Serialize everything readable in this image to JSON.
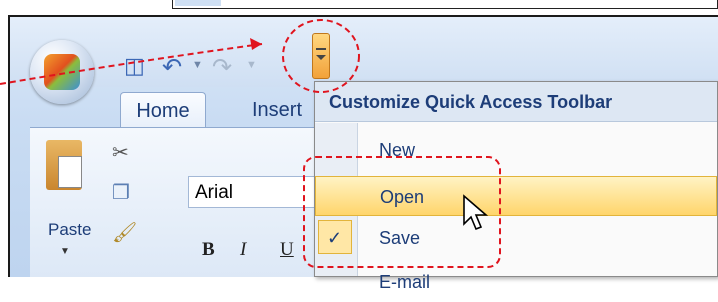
{
  "quick_access": {
    "save_icon": "save-icon",
    "undo_icon": "undo-icon",
    "redo_icon": "redo-icon",
    "customize_icon": "customize-dropdown-icon"
  },
  "tabs": [
    {
      "label": "Home"
    },
    {
      "label": "Insert"
    }
  ],
  "ribbon": {
    "paste_label": "Paste",
    "font_name": "Arial",
    "bold": "B",
    "italic": "I",
    "underline": "U"
  },
  "menu": {
    "title": "Customize Quick Access Toolbar",
    "items": [
      {
        "label": "New",
        "checked": false
      },
      {
        "label": "Open",
        "checked": false,
        "highlighted": true
      },
      {
        "label": "Save",
        "checked": true
      },
      {
        "label": "E-mail",
        "checked": false
      }
    ],
    "check_mark": "✓"
  },
  "colors": {
    "annotation": "#e0141e",
    "highlight": "#ffd56b",
    "menu_text": "#1d3d78"
  }
}
